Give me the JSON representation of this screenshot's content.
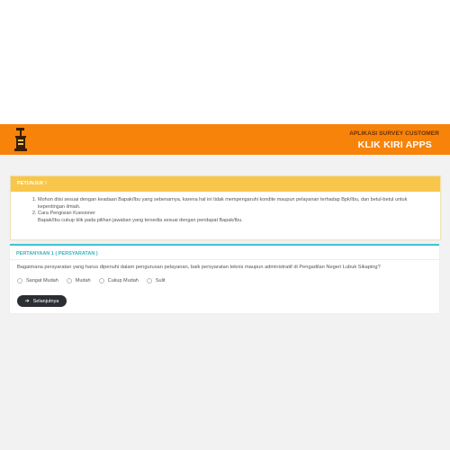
{
  "header": {
    "app_subtitle": "APLIKASI SURVEY CUSTOMER",
    "app_title": "KLIK KIRI APPS",
    "logo_icon": "cocktail-glass-icon"
  },
  "instructions": {
    "title": "PETUNJUK !",
    "items": [
      "Mohon diisi sesuai dengan keadaan Bapak/Ibu yang sebenarnya, karena hal ini tidak mempengaruhi kondite maupun pelayanan terhadap Bpk/Ibu, dan betul-betul untuk kepentingan ilmiah.",
      "Cara Pengisian Kuesioner"
    ],
    "subnote": "Bapak/Ibu cukup klik pada pilihan jawaban yang tersedia sesuai dengan pendapat Bapak/Ibu."
  },
  "question": {
    "heading": "PERTANYAAN 1 ( PERSYARATAN )",
    "text": "Bagaimana persyaratan yang harus dipenuhi dalam pengurusan pelayanan, baik persyaratan teknis maupun administratif di Pengadilan Negeri Lubuk Sikaping?",
    "options": [
      "Sangat Mudah",
      "Mudah",
      "Cukup Mudah",
      "Sulit"
    ],
    "next_label": "Selanjutnya",
    "next_icon": "arrow-right-icon"
  },
  "colors": {
    "header_bg": "#f7830a",
    "warning_header": "#f7c64a",
    "question_accent": "#42c2d6",
    "button_bg": "#2b2e33"
  }
}
